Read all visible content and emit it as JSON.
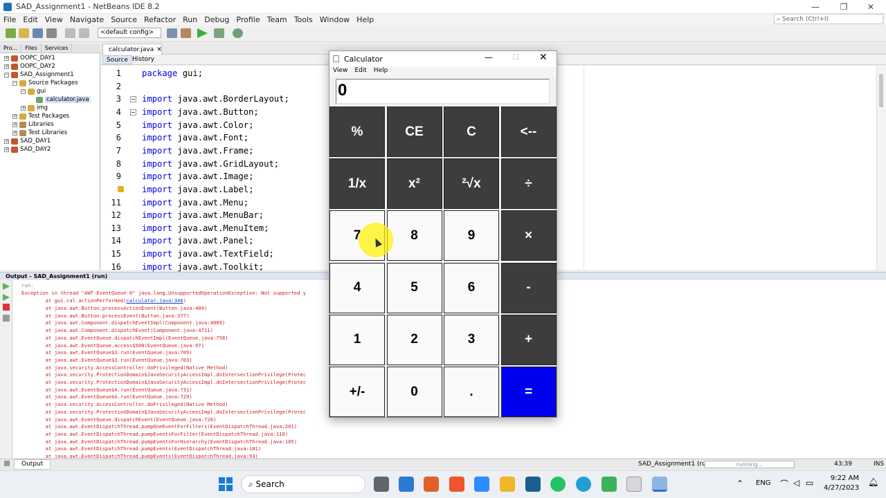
{
  "window": {
    "title": "SAD_Assignment1 - NetBeans IDE 8.2",
    "controls": [
      "—",
      "❐",
      "✕"
    ]
  },
  "menu": [
    "File",
    "Edit",
    "View",
    "Navigate",
    "Source",
    "Refactor",
    "Run",
    "Debug",
    "Profile",
    "Team",
    "Tools",
    "Window",
    "Help"
  ],
  "search": {
    "placeholder": "Search (Ctrl+I)"
  },
  "toolbar": {
    "config": "<default config>"
  },
  "projects": {
    "tabs": [
      "Pro...",
      "Files",
      "Services"
    ],
    "tree": [
      {
        "label": "OOPC_DAY1",
        "icon": "project-icon"
      },
      {
        "label": "OOPC_DAY2",
        "icon": "project-icon"
      },
      {
        "label": "SAD_Assignment1",
        "icon": "project-icon"
      },
      {
        "label": "Source Packages",
        "icon": "package-folder-icon"
      },
      {
        "label": "gui",
        "icon": "package-icon"
      },
      {
        "label": "calculator.java",
        "icon": "java-file-icon"
      },
      {
        "label": "img",
        "icon": "package-icon"
      },
      {
        "label": "Test Packages",
        "icon": "package-folder-icon"
      },
      {
        "label": "Libraries",
        "icon": "library-icon"
      },
      {
        "label": "Test Libraries",
        "icon": "library-icon"
      },
      {
        "label": "SAD_DAY1",
        "icon": "project-icon"
      },
      {
        "label": "SAD_DAY2",
        "icon": "project-icon"
      }
    ]
  },
  "editor": {
    "tab": "calculator.java",
    "source_tab": "Source",
    "history_tab": "History",
    "lines": [
      {
        "n": "1",
        "kw": "package",
        "rest": " gui;"
      },
      {
        "n": "2",
        "kw": "",
        "rest": ""
      },
      {
        "n": "3",
        "kw": "import",
        "rest": " java.awt.BorderLayout;"
      },
      {
        "n": "4",
        "kw": "import",
        "rest": " java.awt.Button;"
      },
      {
        "n": "5",
        "kw": "import",
        "rest": " java.awt.Color;"
      },
      {
        "n": "6",
        "kw": "import",
        "rest": " java.awt.Font;"
      },
      {
        "n": "7",
        "kw": "import",
        "rest": " java.awt.Frame;"
      },
      {
        "n": "8",
        "kw": "import",
        "rest": " java.awt.GridLayout;"
      },
      {
        "n": "9",
        "kw": "import",
        "rest": " java.awt.Image;"
      },
      {
        "n": "",
        "kw": "import",
        "rest": " java.awt.Label;"
      },
      {
        "n": "11",
        "kw": "import",
        "rest": " java.awt.Menu;"
      },
      {
        "n": "12",
        "kw": "import",
        "rest": " java.awt.MenuBar;"
      },
      {
        "n": "13",
        "kw": "import",
        "rest": " java.awt.MenuItem;"
      },
      {
        "n": "14",
        "kw": "import",
        "rest": " java.awt.Panel;"
      },
      {
        "n": "15",
        "kw": "import",
        "rest": " java.awt.TextField;"
      },
      {
        "n": "16",
        "kw": "import",
        "rest": " java.awt.Toolkit;"
      }
    ]
  },
  "output": {
    "title": "Output - SAD_Assignment1 (run)",
    "run": "run:",
    "exception": "Exception in thread \"AWT-EventQueue-0\" java.lang.UnsupportedOperationException: Not supported y",
    "first_pre": "        at gui.cal.actionPerformed(",
    "first_link": "calculator.java:346",
    "first_post": ")",
    "stack": [
      "        at java.awt.Button.processActionEvent(Button.java:409)",
      "        at java.awt.Button.processEvent(Button.java:377)",
      "        at java.awt.Component.dispatchEventImpl(Component.java:4889)",
      "        at java.awt.Component.dispatchEvent(Component.java:4711)",
      "        at java.awt.EventQueue.dispatchEventImpl(EventQueue.java:758)",
      "        at java.awt.EventQueue.access$500(EventQueue.java:97)",
      "        at java.awt.EventQueue$3.run(EventQueue.java:709)",
      "        at java.awt.EventQueue$3.run(EventQueue.java:703)",
      "        at java.security.AccessController.doPrivileged(Native Method)",
      "        at java.security.ProtectionDomain$JavaSecurityAccessImpl.doIntersectionPrivilege(Protec",
      "        at java.security.ProtectionDomain$JavaSecurityAccessImpl.doIntersectionPrivilege(Protec",
      "        at java.awt.EventQueue$4.run(EventQueue.java:731)",
      "        at java.awt.EventQueue$4.run(EventQueue.java:729)",
      "        at java.security.AccessController.doPrivileged(Native Method)",
      "        at java.security.ProtectionDomain$JavaSecurityAccessImpl.doIntersectionPrivilege(Protec",
      "        at java.awt.EventQueue.dispatchEvent(EventQueue.java:728)",
      "        at java.awt.EventDispatchThread.pumpOneEventForFilters(EventDispatchThread.java:201)",
      "        at java.awt.EventDispatchThread.pumpEventsForFilter(EventDispatchThread.java:116)",
      "        at java.awt.EventDispatchThread.pumpEventsForHierarchy(EventDispatchThread.java:105)",
      "        at java.awt.EventDispatchThread.pumpEvents(EventDispatchThread.java:101)",
      "        at java.awt.EventDispatchThread.pumpEvents(EventDispatchThread.java:93)"
    ]
  },
  "statusbar": {
    "output_tab": "Output",
    "project": "SAD_Assignment1 (run)",
    "progress": "running...",
    "position": "43:39",
    "mode": "INS"
  },
  "taskbar": {
    "search": "Search",
    "lang": "ENG",
    "time": "9:22 AM",
    "date": "4/27/2023"
  },
  "calculator": {
    "title": "Calculator",
    "menu": [
      "View",
      "Edit",
      "Help"
    ],
    "display": "0",
    "keys": [
      {
        "label": "%",
        "style": "dark"
      },
      {
        "label": "CE",
        "style": "dark"
      },
      {
        "label": "C",
        "style": "dark"
      },
      {
        "label": "<--",
        "style": "dark"
      },
      {
        "label": "1/x",
        "style": "dark"
      },
      {
        "label": "x²",
        "style": "dark"
      },
      {
        "label": "²√x",
        "style": "dark"
      },
      {
        "label": "÷",
        "style": "dark"
      },
      {
        "label": "7",
        "style": "light"
      },
      {
        "label": "8",
        "style": "light"
      },
      {
        "label": "9",
        "style": "light"
      },
      {
        "label": "×",
        "style": "dark"
      },
      {
        "label": "4",
        "style": "light"
      },
      {
        "label": "5",
        "style": "light"
      },
      {
        "label": "6",
        "style": "light"
      },
      {
        "label": "-",
        "style": "dark"
      },
      {
        "label": "1",
        "style": "light"
      },
      {
        "label": "2",
        "style": "light"
      },
      {
        "label": "3",
        "style": "light"
      },
      {
        "label": "+",
        "style": "dark"
      },
      {
        "label": "+/-",
        "style": "light"
      },
      {
        "label": "0",
        "style": "light"
      },
      {
        "label": ".",
        "style": "light"
      },
      {
        "label": "=",
        "style": "eq"
      }
    ]
  },
  "colors": {
    "equals_key": "#0000ee",
    "dark_key": "#3d3d3d",
    "keyword": "#0000e6",
    "error_text": "#cc2222"
  }
}
